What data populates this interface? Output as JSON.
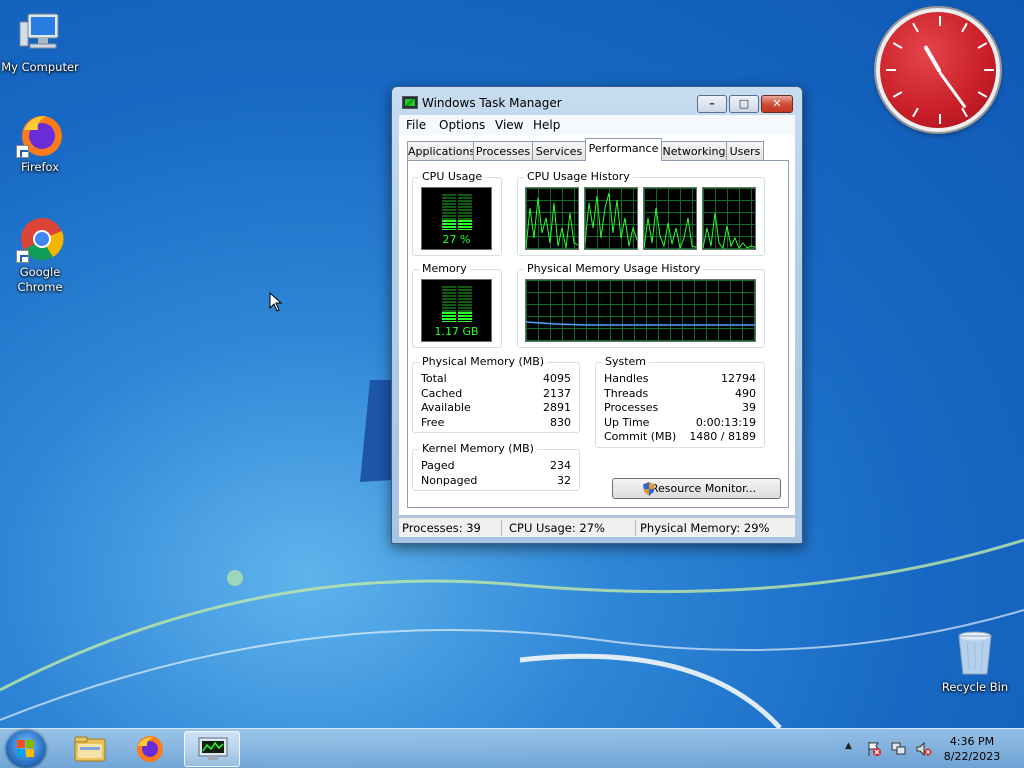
{
  "desktop": {
    "icons": [
      {
        "label": "My Computer"
      },
      {
        "label": "Firefox"
      },
      {
        "label": "Google Chrome"
      },
      {
        "label": "Recycle Bin"
      }
    ]
  },
  "window": {
    "title": "Windows Task Manager",
    "buttons": {
      "minimize": "–",
      "maximize": "□",
      "close": "✕"
    },
    "menu": [
      "File",
      "Options",
      "View",
      "Help"
    ],
    "tabs": [
      "Applications",
      "Processes",
      "Services",
      "Performance",
      "Networking",
      "Users"
    ],
    "active_tab": "Performance",
    "performance": {
      "cpu_usage": {
        "title": "CPU Usage",
        "value_label": "27 %",
        "level": 0.27
      },
      "cpu_history": {
        "title": "CPU Usage History"
      },
      "memory": {
        "title": "Memory",
        "value_label": "1.17 GB",
        "level": 0.29
      },
      "memory_history": {
        "title": "Physical Memory Usage History"
      },
      "physical_memory": {
        "title": "Physical Memory (MB)",
        "rows": [
          {
            "label": "Total",
            "value": "4095"
          },
          {
            "label": "Cached",
            "value": "2137"
          },
          {
            "label": "Available",
            "value": "2891"
          },
          {
            "label": "Free",
            "value": "830"
          }
        ]
      },
      "kernel_memory": {
        "title": "Kernel Memory (MB)",
        "rows": [
          {
            "label": "Paged",
            "value": "234"
          },
          {
            "label": "Nonpaged",
            "value": "32"
          }
        ]
      },
      "system": {
        "title": "System",
        "rows": [
          {
            "label": "Handles",
            "value": "12794"
          },
          {
            "label": "Threads",
            "value": "490"
          },
          {
            "label": "Processes",
            "value": "39"
          },
          {
            "label": "Up Time",
            "value": "0:00:13:19"
          },
          {
            "label": "Commit (MB)",
            "value": "1480 / 8189"
          }
        ]
      },
      "resource_monitor_button": "Resource Monitor..."
    },
    "status": {
      "processes": "Processes: 39",
      "cpu": "CPU Usage: 27%",
      "memory": "Physical Memory: 29%"
    }
  },
  "taskbar": {
    "clock_time": "4:36 PM",
    "clock_date": "8/22/2023",
    "tray_arrow": "▲"
  },
  "colors": {
    "graph_green": "#2bff2b",
    "clock_red": "#c81e28"
  }
}
